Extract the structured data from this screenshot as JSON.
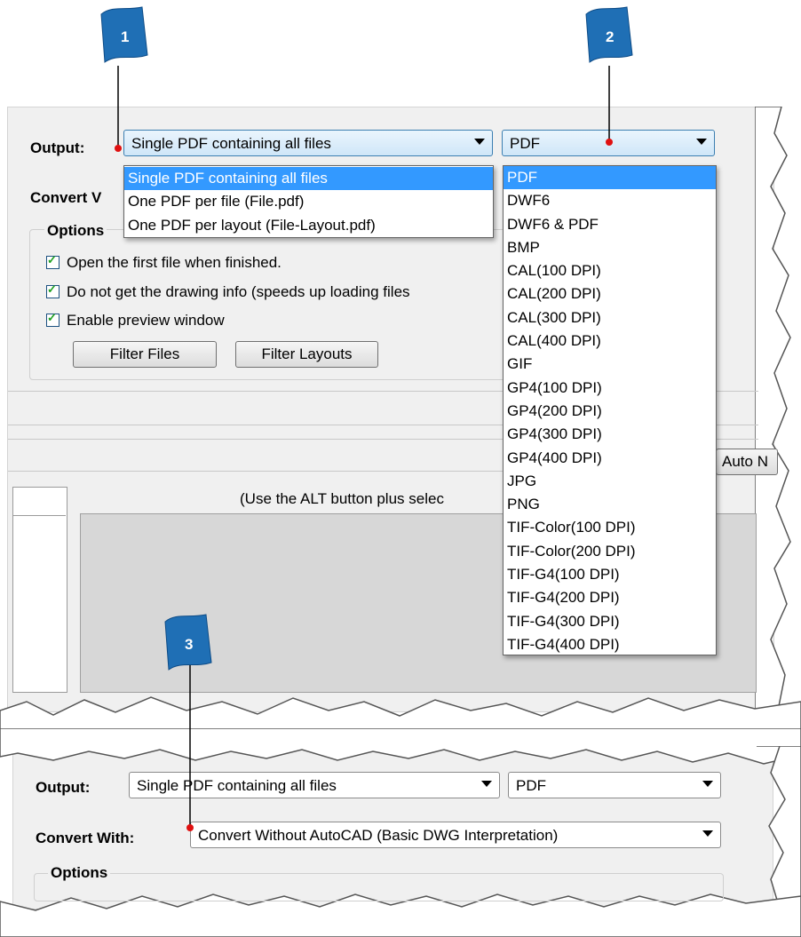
{
  "callouts": [
    "1",
    "2",
    "3"
  ],
  "top": {
    "output_label": "Output:",
    "output_mode": "Single PDF containing all files",
    "output_format": "PDF",
    "convert_label_partial": "Convert V",
    "options_label": "Options",
    "mode_options": [
      "Single PDF containing all files",
      "One PDF per file (File.pdf)",
      "One PDF per layout (File-Layout.pdf)"
    ],
    "format_options": [
      "PDF",
      "DWF6",
      "DWF6 & PDF",
      "BMP",
      "CAL(100 DPI)",
      "CAL(200 DPI)",
      "CAL(300 DPI)",
      "CAL(400 DPI)",
      "GIF",
      "GP4(100 DPI)",
      "GP4(200 DPI)",
      "GP4(300 DPI)",
      "GP4(400 DPI)",
      "JPG",
      "PNG",
      "TIF-Color(100 DPI)",
      "TIF-Color(200 DPI)",
      "TIF-G4(100 DPI)",
      "TIF-G4(200 DPI)",
      "TIF-G4(300 DPI)",
      "TIF-G4(400 DPI)"
    ],
    "checkboxes": [
      {
        "label": "Open the first file when finished.",
        "checked": true
      },
      {
        "label": "Do not get the drawing info (speeds up loading files",
        "checked": true
      },
      {
        "label": "Enable preview window",
        "checked": true
      }
    ],
    "filter_files_label": "Filter Files",
    "filter_layouts_label": "Filter Layouts",
    "auto_button_partial": "Auto N",
    "alt_hint_partial": "(Use the ALT button plus selec"
  },
  "bottom": {
    "output_label": "Output:",
    "output_mode": "Single PDF containing all files",
    "output_format": "PDF",
    "convert_label": "Convert With:",
    "convert_value": "Convert Without AutoCAD (Basic DWG Interpretation)",
    "options_label": "Options"
  },
  "colors": {
    "callout_blue": "#1f6fb5",
    "selection_blue": "#3399ff",
    "marker_red": "#e01010"
  }
}
